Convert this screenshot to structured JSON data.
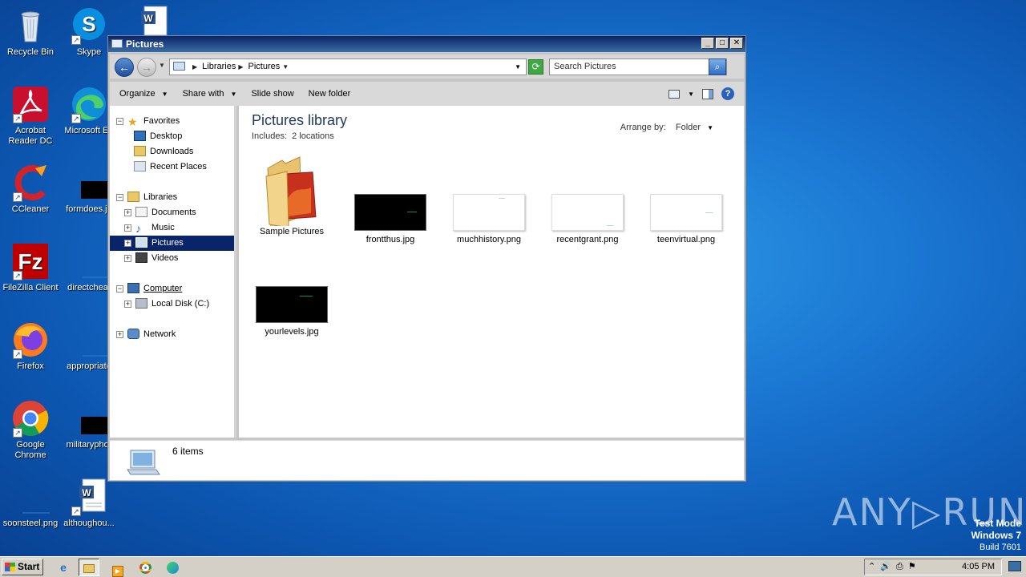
{
  "desktop": {
    "icons": [
      {
        "label": "Recycle Bin"
      },
      {
        "label": "Skype"
      },
      {
        "label": "Acrobat Reader DC"
      },
      {
        "label": "Microsoft Ed"
      },
      {
        "label": "CCleaner"
      },
      {
        "label": "formdoes.jp"
      },
      {
        "label": "FileZilla Client"
      },
      {
        "label": "directchea."
      },
      {
        "label": "Firefox"
      },
      {
        "label": "appropriate"
      },
      {
        "label": "Google Chrome"
      },
      {
        "label": "militaryphor"
      },
      {
        "label": "soonsteel.png"
      },
      {
        "label": "althoughou..."
      }
    ]
  },
  "window": {
    "title": "Pictures",
    "address": {
      "crumb1": "Libraries",
      "crumb2": "Pictures"
    },
    "search_placeholder": "Search Pictures",
    "toolbar": {
      "organize": "Organize",
      "share": "Share with",
      "slideshow": "Slide show",
      "newfolder": "New folder"
    },
    "nav": {
      "favorites": "Favorites",
      "desktop": "Desktop",
      "downloads": "Downloads",
      "recent": "Recent Places",
      "libraries": "Libraries",
      "documents": "Documents",
      "music": "Music",
      "pictures": "Pictures",
      "videos": "Videos",
      "computer": "Computer",
      "localdisk": "Local Disk (C:)",
      "network": "Network"
    },
    "content": {
      "title": "Pictures library",
      "includes_label": "Includes:",
      "includes_value": "2 locations",
      "arrange_label": "Arrange by:",
      "arrange_value": "Folder",
      "files": [
        {
          "name": "Sample Pictures",
          "kind": "folder"
        },
        {
          "name": "frontthus.jpg",
          "kind": "black"
        },
        {
          "name": "muchhistory.png",
          "kind": "white"
        },
        {
          "name": "recentgrant.png",
          "kind": "white"
        },
        {
          "name": "teenvirtual.png",
          "kind": "white"
        },
        {
          "name": "yourlevels.jpg",
          "kind": "black"
        }
      ]
    },
    "details": {
      "count": "6 items"
    }
  },
  "taskbar": {
    "start": "Start",
    "time": "4:05 PM"
  },
  "watermark": {
    "line1": "Test Mode",
    "line2": "Windows 7",
    "line3": "Build 7601",
    "brand": "ANY▷RUN"
  }
}
